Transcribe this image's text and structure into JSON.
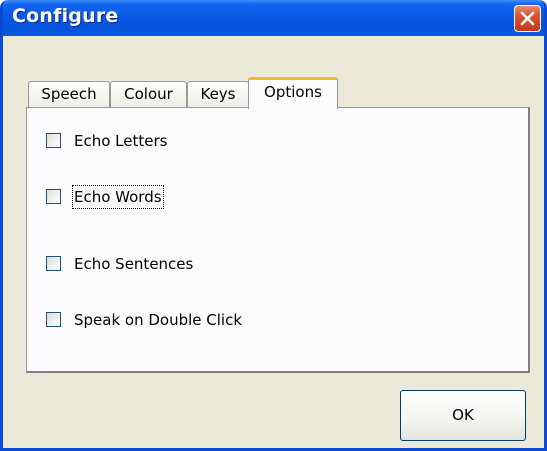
{
  "window": {
    "title": "Configure",
    "close_icon": "close-icon"
  },
  "tabs": [
    {
      "label": "Speech",
      "active": false
    },
    {
      "label": "Colour",
      "active": false
    },
    {
      "label": "Keys",
      "active": false
    },
    {
      "label": "Options",
      "active": true
    }
  ],
  "options": {
    "echo_letters": {
      "label": "Echo Letters",
      "checked": false
    },
    "echo_words": {
      "label": "Echo Words",
      "checked": false,
      "focused": true
    },
    "echo_sentences": {
      "label": "Echo Sentences",
      "checked": false
    },
    "speak_double_click": {
      "label": "Speak on Double Click",
      "checked": false
    }
  },
  "buttons": {
    "ok_label": "OK"
  },
  "colors": {
    "titlebar": "#0a59e6",
    "window_bg": "#ece9d8",
    "active_tab_accent": "#f7b63a",
    "close_button": "#d9532f"
  }
}
